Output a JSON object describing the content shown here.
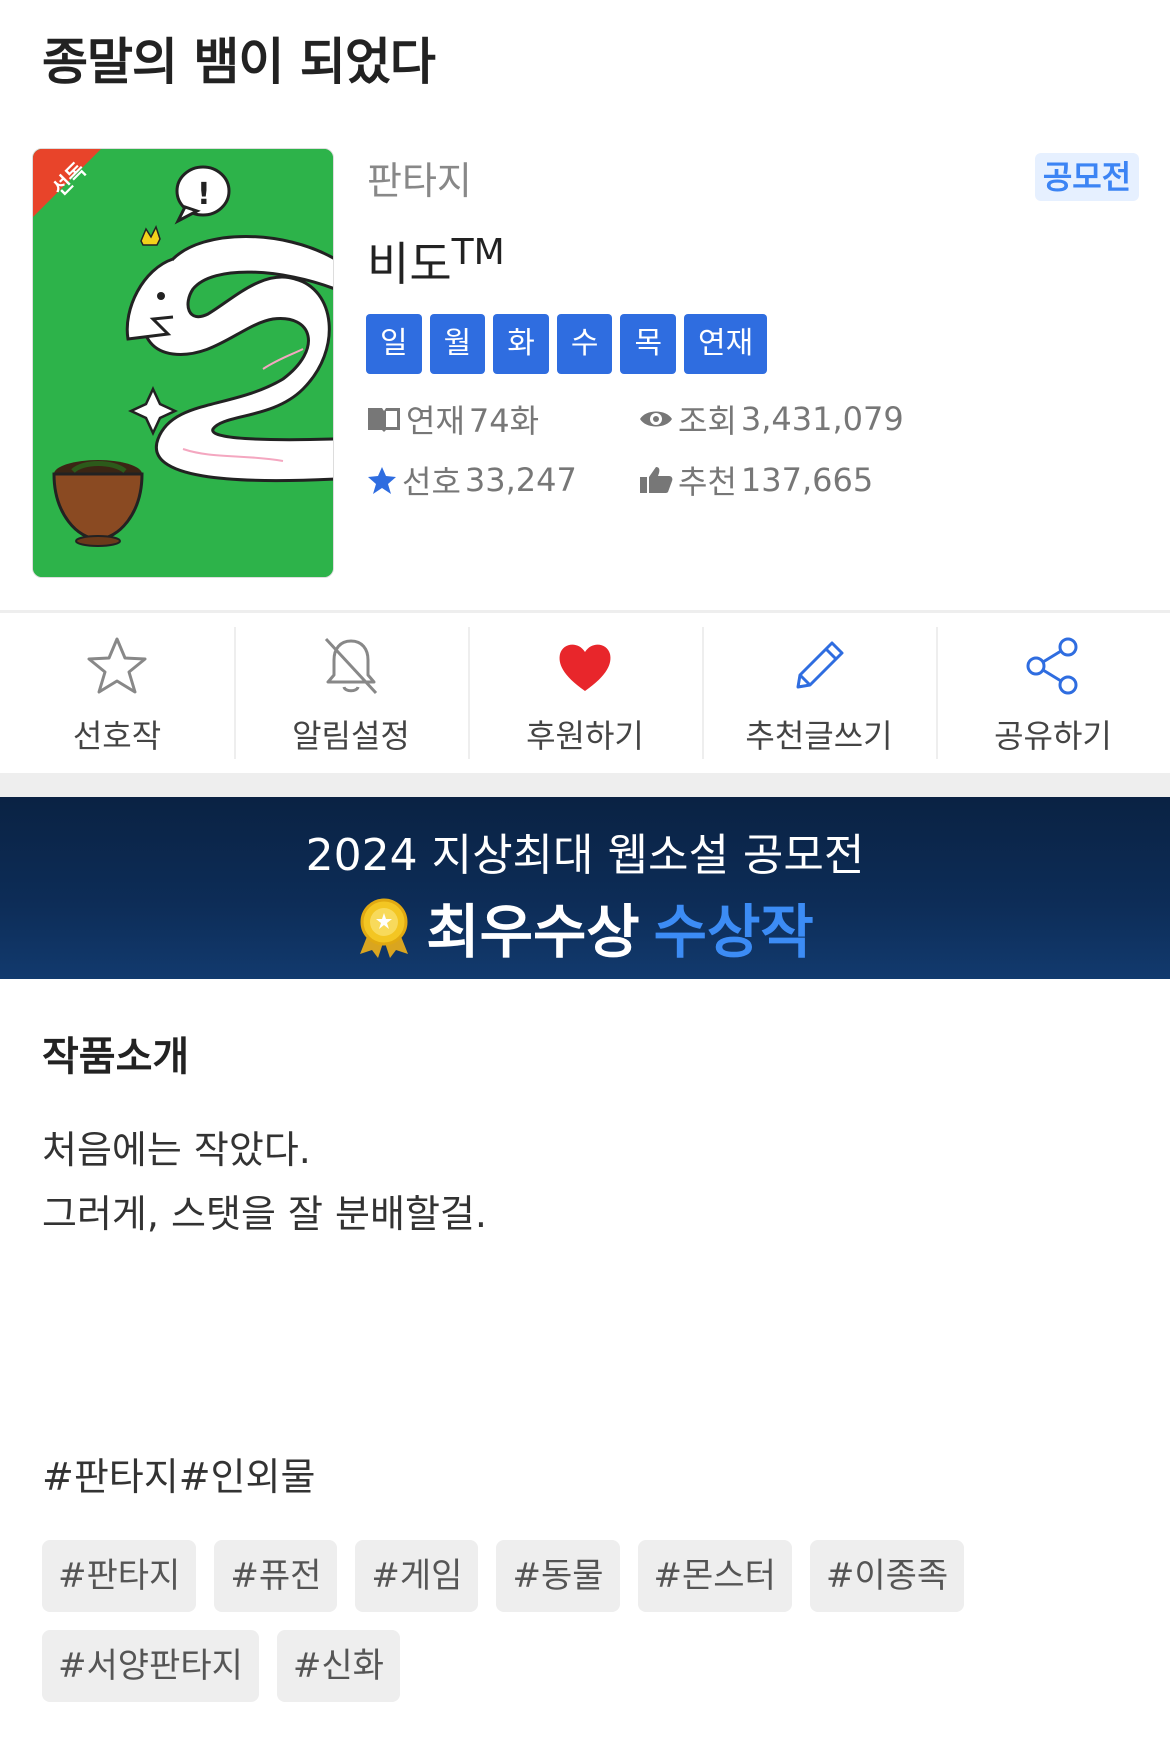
{
  "novel": {
    "title": "종말의 뱀이 되었다",
    "genre": "판타지",
    "contest_badge": "공모전",
    "author": "비도",
    "author_mark": "TM",
    "cover_ribbon": "선독",
    "days": [
      "일",
      "월",
      "화",
      "수",
      "목",
      "연재"
    ],
    "stats": {
      "episodes_label": "연재",
      "episodes_value": "74화",
      "views_label": "조회",
      "views_value": "3,431,079",
      "favorites_label": "선호",
      "favorites_value": "33,247",
      "recommends_label": "추천",
      "recommends_value": "137,665"
    }
  },
  "actions": [
    {
      "label": "선호작",
      "icon": "star-outline-icon"
    },
    {
      "label": "알림설정",
      "icon": "bell-off-icon"
    },
    {
      "label": "후원하기",
      "icon": "heart-icon"
    },
    {
      "label": "추천글쓰기",
      "icon": "pencil-icon"
    },
    {
      "label": "공유하기",
      "icon": "share-icon"
    }
  ],
  "banner": {
    "line1": "2024 지상최대 웹소설 공모전",
    "award": "최우수상",
    "award_highlight": "수상작"
  },
  "intro": {
    "heading": "작품소개",
    "lines": [
      "처음에는 작았다.",
      "그러게, 스탯을 잘 분배할걸."
    ],
    "hashtags_text": "#판타지#인외물"
  },
  "tags": [
    "#판타지",
    "#퓨전",
    "#게임",
    "#동물",
    "#몬스터",
    "#이종족",
    "#서양판타지",
    "#신화"
  ],
  "colors": {
    "accent_blue": "#2f6de0",
    "badge_blue": "#3c84f4",
    "heart_red": "#e8262b",
    "cover_green": "#2db34a",
    "banner_navy": "#0d2d58"
  }
}
